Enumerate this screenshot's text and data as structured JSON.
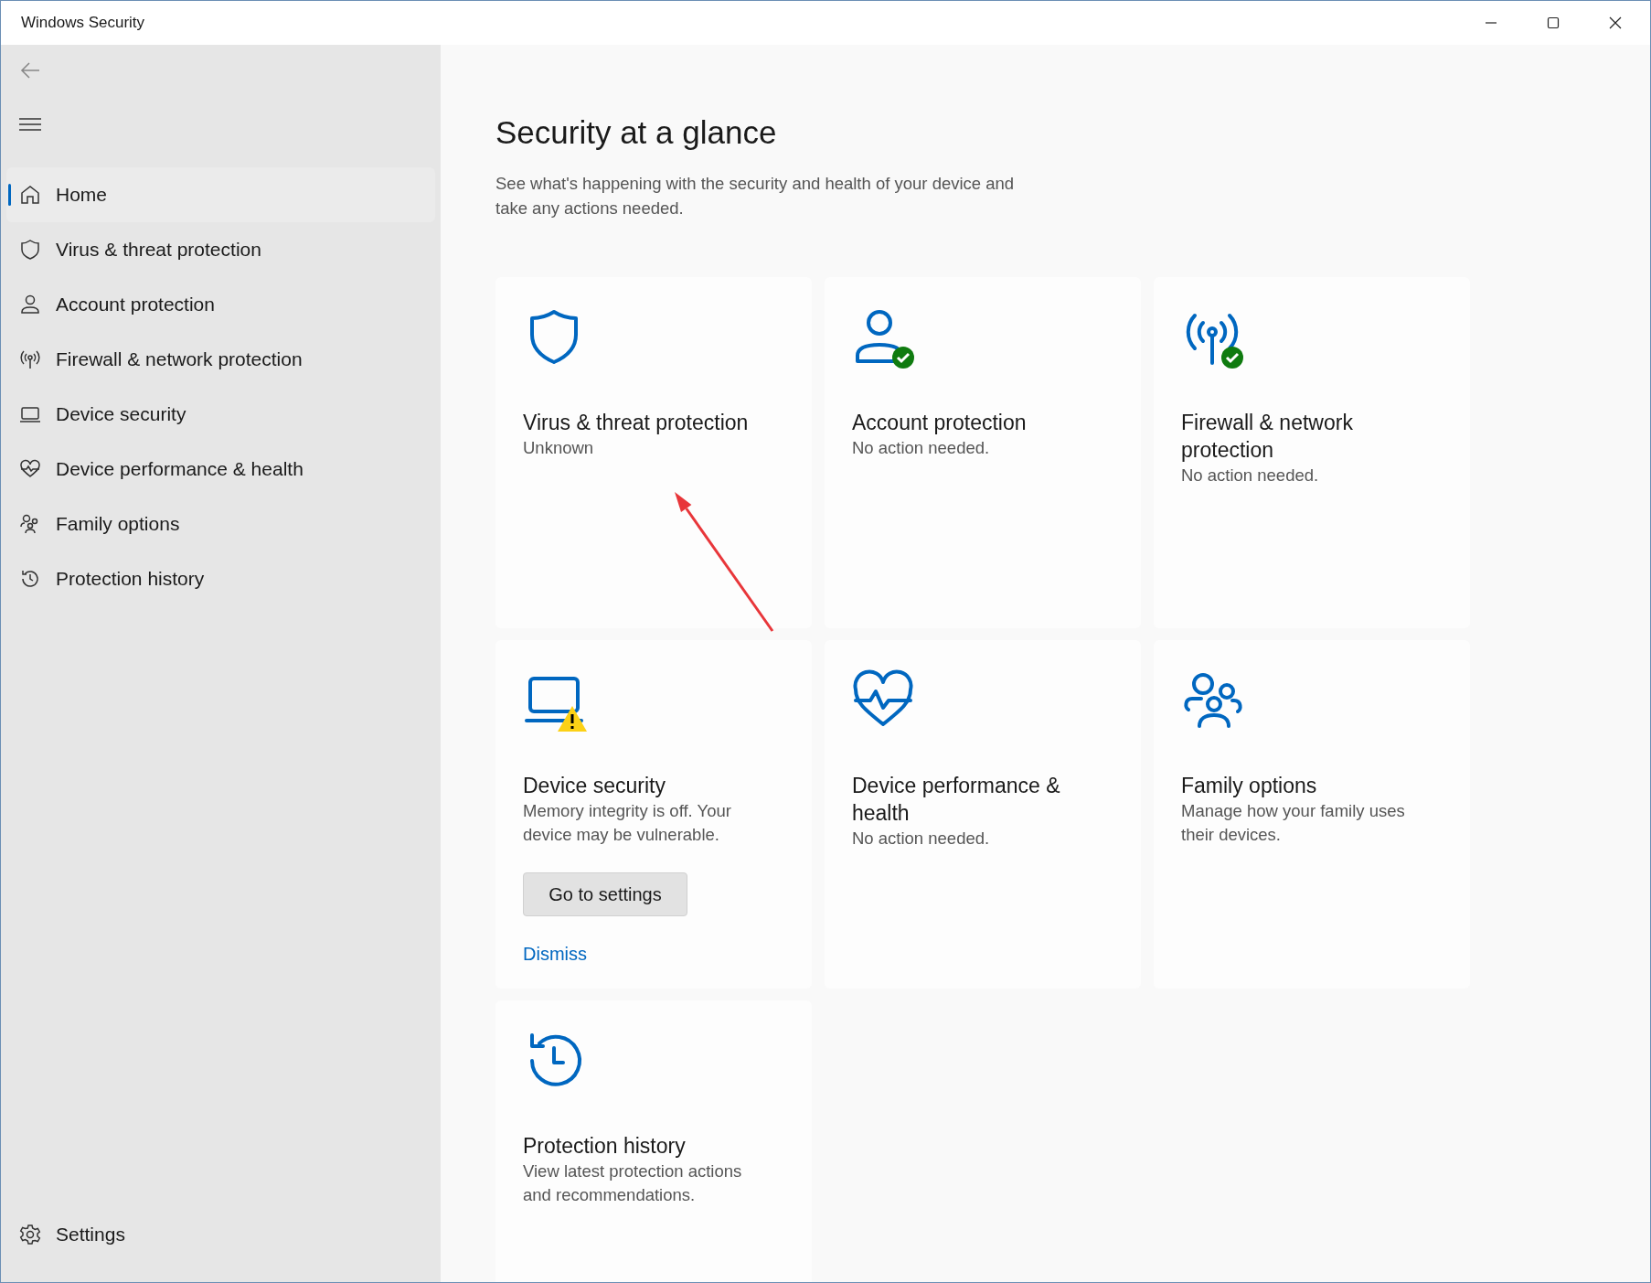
{
  "window": {
    "title": "Windows Security"
  },
  "sidebar": {
    "items": [
      {
        "label": "Home",
        "selected": true
      },
      {
        "label": "Virus & threat protection",
        "selected": false
      },
      {
        "label": "Account protection",
        "selected": false
      },
      {
        "label": "Firewall & network protection",
        "selected": false
      },
      {
        "label": "Device security",
        "selected": false
      },
      {
        "label": "Device performance & health",
        "selected": false
      },
      {
        "label": "Family options",
        "selected": false
      },
      {
        "label": "Protection history",
        "selected": false
      }
    ],
    "settings": "Settings"
  },
  "page": {
    "title": "Security at a glance",
    "subtitle": "See what's happening with the security and health of your device and take any actions needed."
  },
  "cards": [
    {
      "kind": "plain",
      "title": "Virus & threat protection",
      "status": "Unknown"
    },
    {
      "kind": "ok",
      "title": "Account protection",
      "status": "No action needed."
    },
    {
      "kind": "ok",
      "title": "Firewall & network protection",
      "status": "No action needed."
    },
    {
      "kind": "warning",
      "title": "Device security",
      "status": "Memory integrity is off. Your device may be vulnerable.",
      "button": "Go to settings",
      "link": "Dismiss"
    },
    {
      "kind": "plain",
      "title": "Device performance & health",
      "status": "No action needed."
    },
    {
      "kind": "plain",
      "title": "Family options",
      "status": "Manage how your family uses their devices."
    },
    {
      "kind": "plain",
      "title": "Protection history",
      "status": "View latest protection actions and recommendations."
    }
  ]
}
